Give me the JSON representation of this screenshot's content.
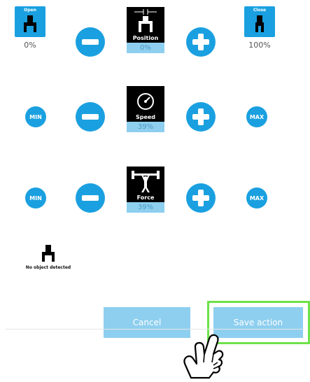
{
  "position_row": {
    "open": {
      "label": "Open",
      "value": "0%"
    },
    "close": {
      "label": "Close",
      "value": "100%"
    },
    "card": {
      "title": "Position",
      "value": "0%"
    }
  },
  "speed_row": {
    "min_label": "MIN",
    "max_label": "MAX",
    "card": {
      "title": "Speed",
      "value": "39%"
    }
  },
  "force_row": {
    "min_label": "MIN",
    "max_label": "MAX",
    "card": {
      "title": "Force",
      "value": "39%"
    }
  },
  "status": {
    "text": "No object detected"
  },
  "footer": {
    "cancel_label": "Cancel",
    "save_label": "Save action"
  },
  "colors": {
    "accent": "#1aa0e0",
    "button": "#8ecfef",
    "highlight": "#6de24a"
  }
}
